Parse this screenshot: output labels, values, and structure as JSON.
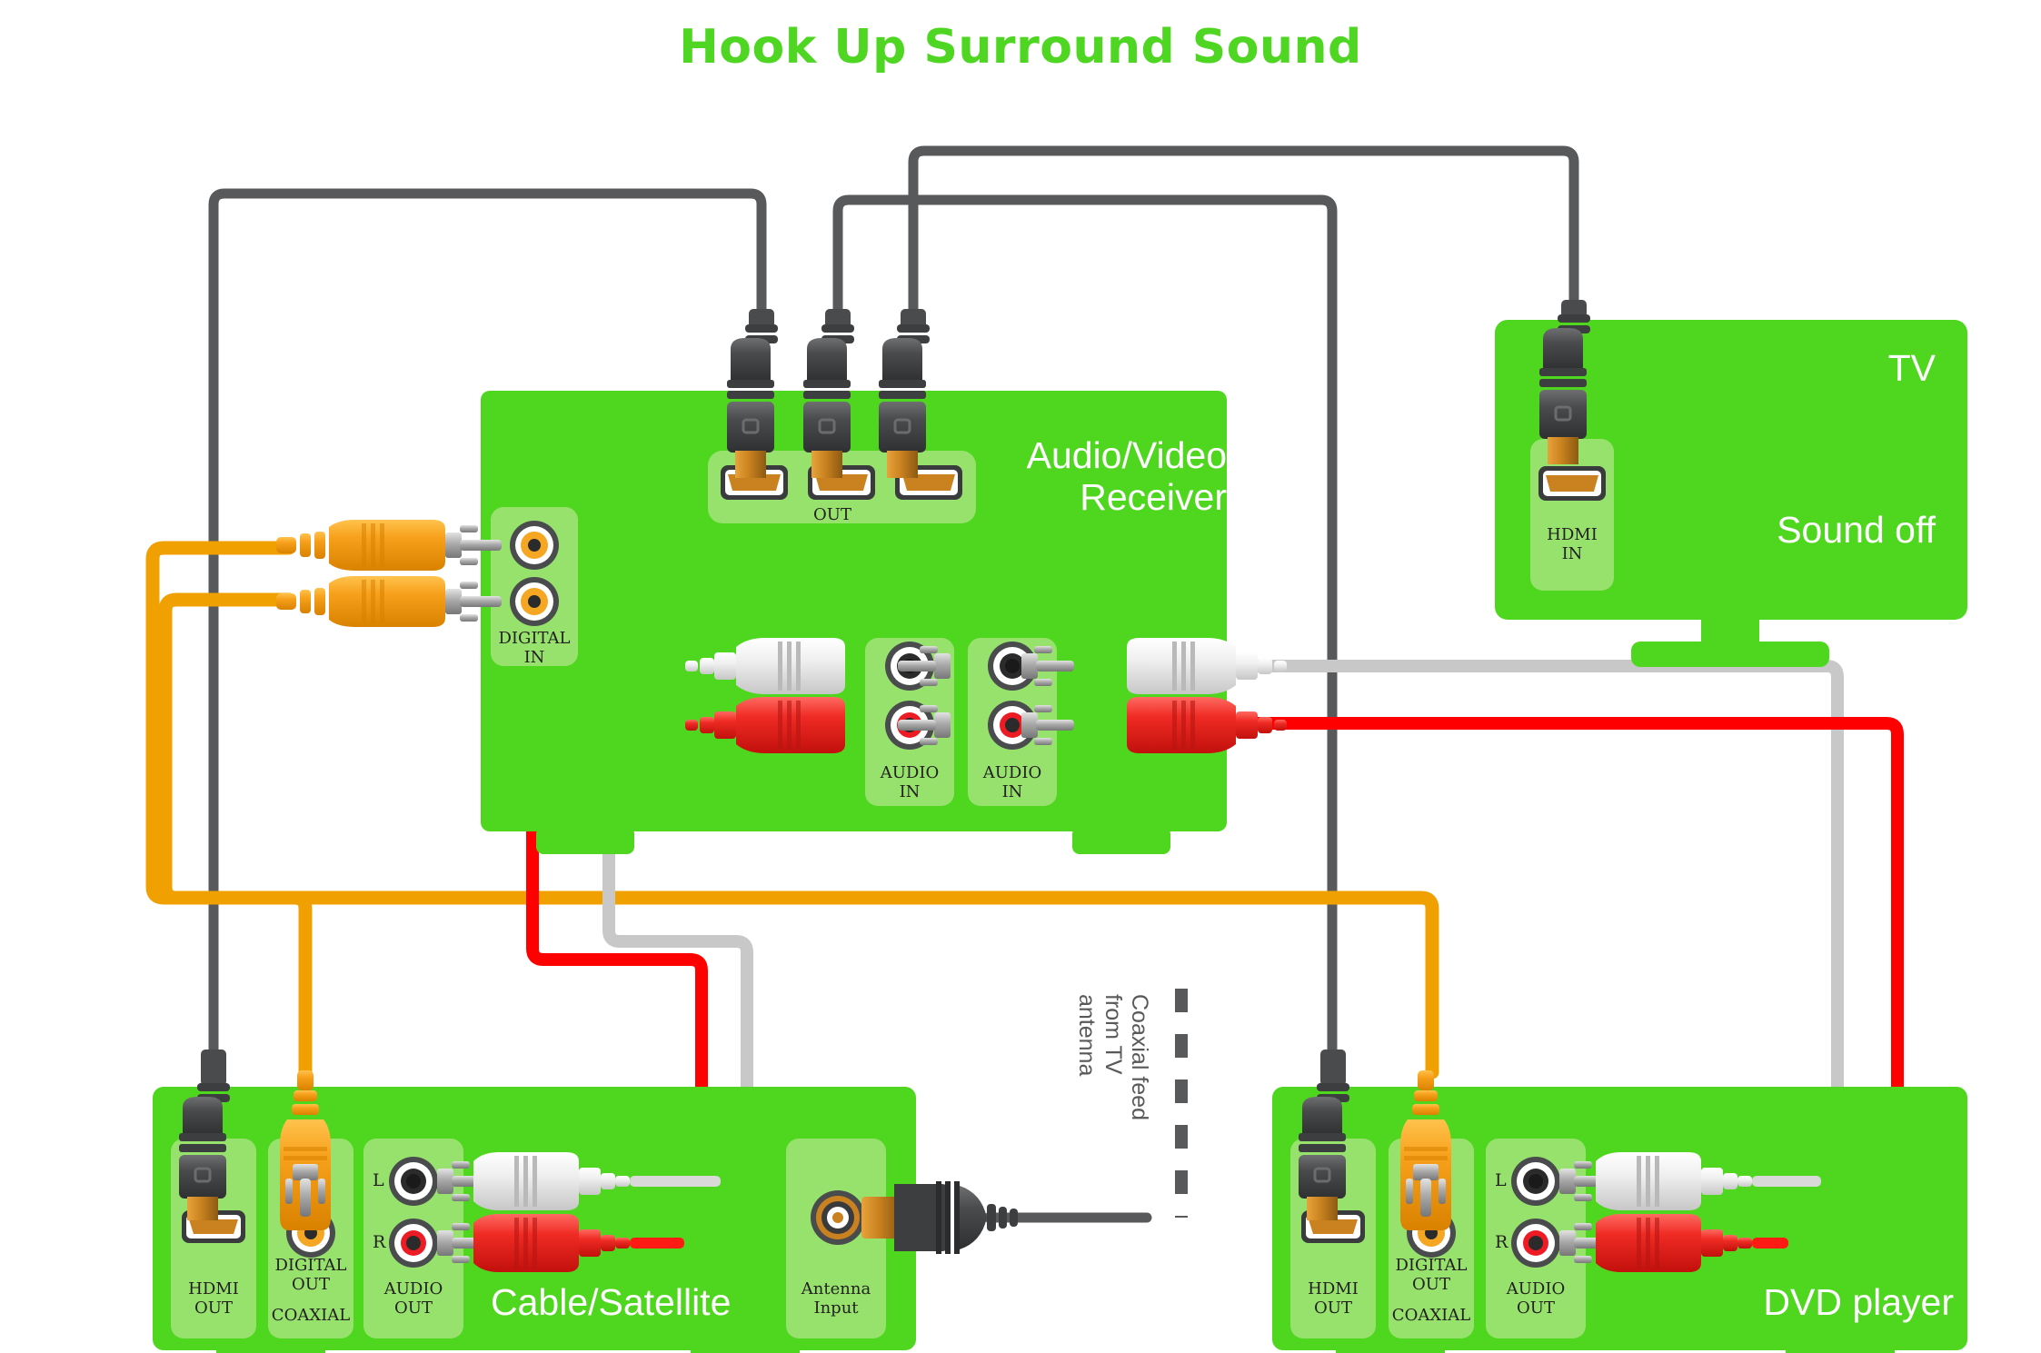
{
  "title": "Hook Up Surround Sound",
  "colors": {
    "device_green": "#4fd61f",
    "panel_green": "#96e26c",
    "title_green": "#4ed622",
    "hdmi_cable": "#58595b",
    "coax_cable": "#f0a000",
    "audio_left_cable": "#c8c8c8",
    "audio_right_cable": "#ff0000",
    "label_text": "#231f20",
    "device_name_text": "#ffffff"
  },
  "devices": {
    "receiver": {
      "name": "Audio/Video\nReceiver",
      "ports": [
        {
          "id": "hdmi-out",
          "label": "OUT",
          "type": "hdmi",
          "count": 3
        },
        {
          "id": "digital-in",
          "label": "DIGITAL\nIN",
          "type": "rca-coax",
          "count": 2
        },
        {
          "id": "audio-in-1",
          "label": "AUDIO\nIN",
          "type": "rca-pair"
        },
        {
          "id": "audio-in-2",
          "label": "AUDIO\nIN",
          "type": "rca-pair"
        }
      ]
    },
    "tv": {
      "name": "TV",
      "status": "Sound off",
      "ports": [
        {
          "id": "hdmi-in",
          "label": "HDMI\nIN",
          "type": "hdmi"
        }
      ]
    },
    "cable_satellite": {
      "name": "Cable/Satellite",
      "ports": [
        {
          "id": "hdmi-out",
          "label": "HDMI\nOUT",
          "type": "hdmi"
        },
        {
          "id": "digital-out",
          "label": "DIGITAL\nOUT",
          "sublabel": "COAXIAL",
          "type": "rca-coax"
        },
        {
          "id": "audio-out",
          "label": "AUDIO\nOUT",
          "type": "rca-pair",
          "channels": [
            "L",
            "R"
          ]
        },
        {
          "id": "antenna-input",
          "label": "Antenna\nInput",
          "type": "f-connector"
        }
      ]
    },
    "dvd_player": {
      "name": "DVD player",
      "ports": [
        {
          "id": "hdmi-out",
          "label": "HDMI\nOUT",
          "type": "hdmi"
        },
        {
          "id": "digital-out",
          "label": "DIGITAL\nOUT",
          "sublabel": "COAXIAL",
          "type": "rca-coax"
        },
        {
          "id": "audio-out",
          "label": "AUDIO\nOUT",
          "type": "rca-pair",
          "channels": [
            "L",
            "R"
          ]
        }
      ]
    }
  },
  "annotations": {
    "wall_feed": "Coaxial feed\nfrom TV\nantenna"
  },
  "channel_labels": {
    "left": "L",
    "right": "R"
  }
}
